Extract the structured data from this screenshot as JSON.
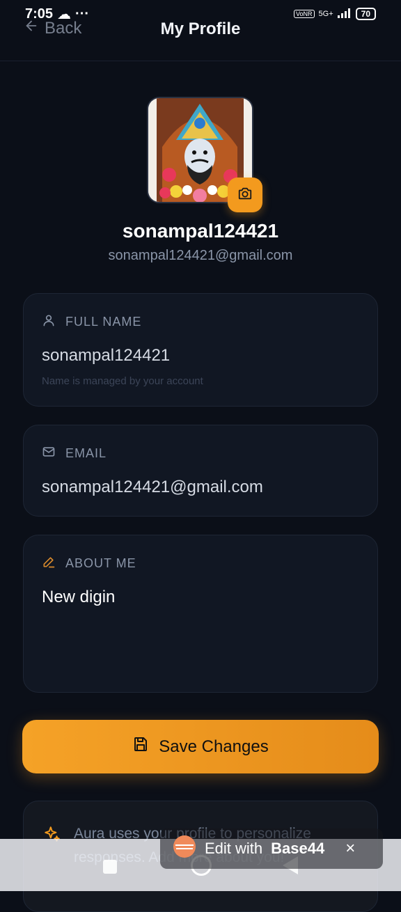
{
  "status": {
    "time": "7:05",
    "network": "5G+",
    "battery": "70"
  },
  "header": {
    "back_label": "Back",
    "title": "My Profile"
  },
  "profile": {
    "username": "sonampal124421",
    "email": "sonampal124421@gmail.com"
  },
  "fields": {
    "full_name": {
      "label": "FULL NAME",
      "value": "sonampal124421",
      "hint": "Name is managed by your account"
    },
    "email": {
      "label": "EMAIL",
      "value": "sonampal124421@gmail.com"
    },
    "about": {
      "label": "ABOUT ME",
      "value": "New digin"
    }
  },
  "save_button": {
    "label": "Save Changes"
  },
  "info": {
    "text": "Aura uses your profile to personalize responses. Add more about you!"
  },
  "edit_overlay": {
    "prefix": "Edit with",
    "brand": "Base44",
    "close": "×"
  },
  "colors": {
    "accent": "#f39a1e",
    "background": "#0b0f18",
    "card": "#111723"
  }
}
